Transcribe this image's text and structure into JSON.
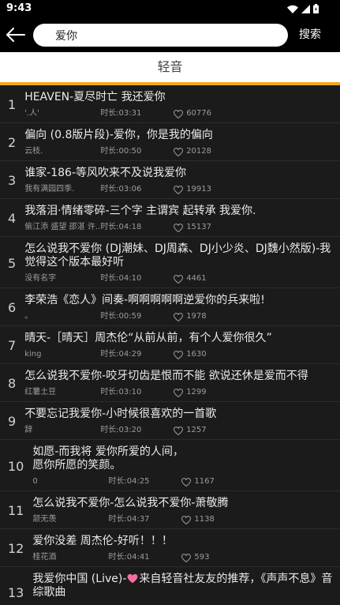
{
  "status_bar": {
    "time": "9:43",
    "icons": [
      "wifi-icon",
      "signal-icon",
      "battery-icon"
    ]
  },
  "header": {
    "back_icon": "arrow-left-icon",
    "search_value": "爱你",
    "search_button": "搜索"
  },
  "tabs": [
    {
      "label": "轻音",
      "active": true
    }
  ],
  "colors": {
    "accent": "#f3a620",
    "header_background": "#000000",
    "list_background": "#1b1b1b",
    "pink_heart": "#f26ea0"
  },
  "results": [
    {
      "index": "1",
      "title": "HEAVEN-夏尽时亡 我还爱你",
      "author": "'.人'",
      "duration": "时长:03:31",
      "likes": "60776"
    },
    {
      "index": "2",
      "title": "偏向 (0.8版片段)-爱你，你是我的偏向",
      "author": "云枝.",
      "duration": "时长:00:50",
      "likes": "20128"
    },
    {
      "index": "3",
      "title": "谁家-186-等风吹来不及说我爱你",
      "author": "我有满园四季.",
      "duration": "时长:03:06",
      "likes": "19913"
    },
    {
      "index": "4",
      "title": "我落泪·情绪零碎-三个字 主谓宾 起转承 我爱你.",
      "author": "偷江添 盛望 邵湛 许...",
      "duration": "时长:04:18",
      "likes": "15137"
    },
    {
      "index": "5",
      "title": "怎么说我不爱你 (DJ潮妹、DJ周森、DJ小少炎、DJ魏小然版)-我觉得这个版本最好听",
      "author": "没有名字",
      "duration": "时长:04:10",
      "likes": "4461"
    },
    {
      "index": "6",
      "title": "李荣浩《恋人》间奏-啊啊啊啊啊逆爱你的兵来啦!",
      "author": "。",
      "duration": "时长:00:59",
      "likes": "1978"
    },
    {
      "index": "7",
      "title": "晴天-［晴天］周杰伦“从前从前，有个人爱你很久”",
      "author": "king",
      "duration": "时长:04:29",
      "likes": "1630"
    },
    {
      "index": "8",
      "title": "怎么说我不爱你-咬牙切齿是恨而不能 欲说还休是爱而不得",
      "author": "红薯土豆",
      "duration": "时长:03:10",
      "likes": "1299"
    },
    {
      "index": "9",
      "title": "不要忘记我爱你-小时候很喜欢的一首歌",
      "author": "辞",
      "duration": "时长:03:20",
      "likes": "1257"
    },
    {
      "index": "10",
      "title": "如愿-而我将 爱你所爱的人间，\n愿你所愿的笑颜。",
      "author": "0",
      "duration": "时长:04:25",
      "likes": "1167"
    },
    {
      "index": "11",
      "title": "怎么说我不爱你-怎么说我不爱你-萧敬腾",
      "author": "颔无羡",
      "duration": "时长:04:37",
      "likes": "1138"
    },
    {
      "index": "12",
      "title": "爱你没差 周杰伦-好听！！！",
      "author": "桂花酒",
      "duration": "时长:04:41",
      "likes": "593"
    },
    {
      "index": "13",
      "title": "我爱你中国 (Live)-",
      "title_icon": "pink-heart-icon",
      "title_rest": "来自轻音社友友的推荐，《声声不息》音综歌曲"
    }
  ]
}
